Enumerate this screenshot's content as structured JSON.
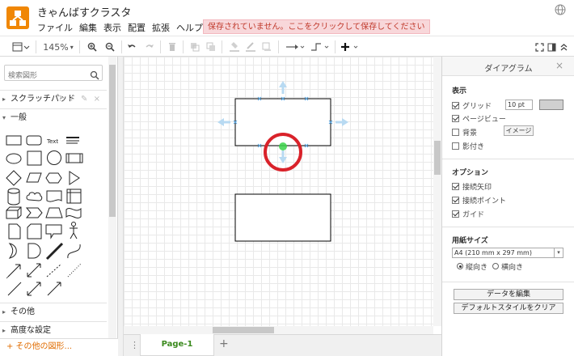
{
  "app": {
    "title": "きゃんばすクラスタ",
    "save_warning": "保存されていません。ここをクリックして保存してください"
  },
  "menu": [
    "ファイル",
    "編集",
    "表示",
    "配置",
    "拡張",
    "ヘルプ"
  ],
  "toolbar": {
    "zoom": "145%"
  },
  "left_panel": {
    "search_placeholder": "検索図形",
    "scratchpad": "スクラッチパッド",
    "scratch_tools": "? + ✎ ×",
    "general": "一般",
    "other": "その他",
    "advanced": "高度な設定",
    "more_shapes": "+ その他の図形..."
  },
  "pages": {
    "tab": "Page-1"
  },
  "right_panel": {
    "title": "ダイアグラム",
    "display_title": "表示",
    "grid_label": "グリッド",
    "grid_size": "10 pt",
    "page_view_label": "ページビュー",
    "background_label": "背景",
    "image_button": "イメージ",
    "shadow_label": "影付き",
    "options_title": "オプション",
    "connection_arrows": "接続矢印",
    "connection_points": "接続ポイント",
    "guides": "ガイド",
    "paper_size_title": "用紙サイズ",
    "paper_size_value": "A4 (210 mm x 297 mm)",
    "portrait": "縦向き",
    "landscape": "横向き",
    "edit_data_button": "データを編集",
    "clear_style_button": "デフォルトスタイルをクリア"
  },
  "colors": {
    "logo": "#f08705",
    "save_warning_bg": "#f8d7da",
    "annotation_circle": "#d9222a",
    "connection_point": "#3bd44a"
  }
}
